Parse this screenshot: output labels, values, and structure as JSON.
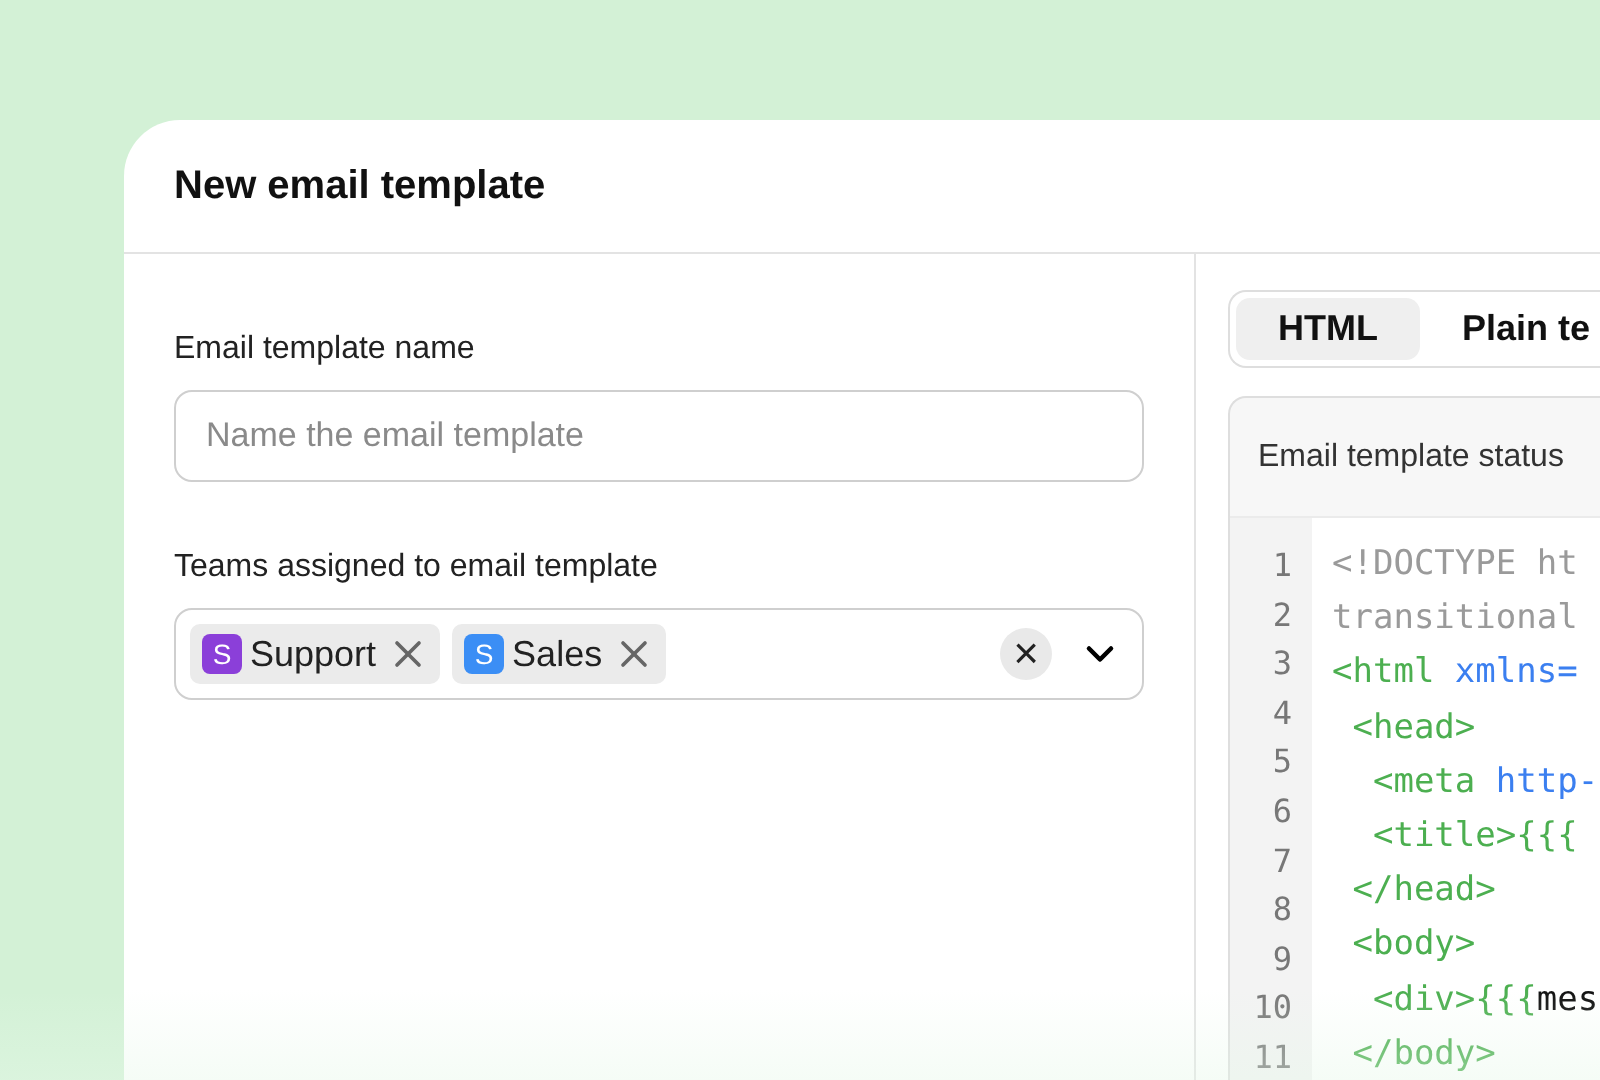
{
  "dialog": {
    "title": "New email template"
  },
  "name_field": {
    "label": "Email template name",
    "placeholder": "Name the email template"
  },
  "teams_field": {
    "label": "Teams assigned to email template",
    "clear": "×",
    "tags": [
      {
        "initial": "S",
        "label": "Support",
        "color": "#8b3fd9"
      },
      {
        "initial": "S",
        "label": "Sales",
        "color": "#3b8ef5"
      }
    ]
  },
  "tabs": [
    {
      "label": "HTML",
      "selected": true
    },
    {
      "label": "Plain te",
      "selected": false
    }
  ],
  "editor": {
    "header": "Email template status",
    "line_numbers": [
      "1",
      "2",
      "3",
      "4",
      "5",
      "6",
      "7",
      "8",
      "9",
      "10",
      "11"
    ],
    "lines": [
      [
        {
          "kind": "doctype",
          "text": "<!DOCTYPE ht"
        }
      ],
      [
        {
          "kind": "doctype",
          "text": "transitional"
        }
      ],
      [
        {
          "kind": "tag",
          "text": "<html"
        },
        {
          "kind": "attr",
          "text": " xmlns="
        }
      ],
      [
        {
          "kind": "tag",
          "text": " <head>"
        }
      ],
      [
        {
          "kind": "tag",
          "text": "  <meta"
        },
        {
          "kind": "attr",
          "text": " http-"
        }
      ],
      [
        {
          "kind": "tag",
          "text": "  <title>{{{"
        }
      ],
      [
        {
          "kind": "tag",
          "text": " </head>"
        }
      ],
      [
        {
          "kind": "tag",
          "text": " <body>"
        }
      ],
      [
        {
          "kind": "tag",
          "text": "  <div>{{{"
        },
        {
          "kind": "plain",
          "text": "mes"
        }
      ],
      [
        {
          "kind": "tag",
          "text": " </body>"
        }
      ]
    ]
  }
}
